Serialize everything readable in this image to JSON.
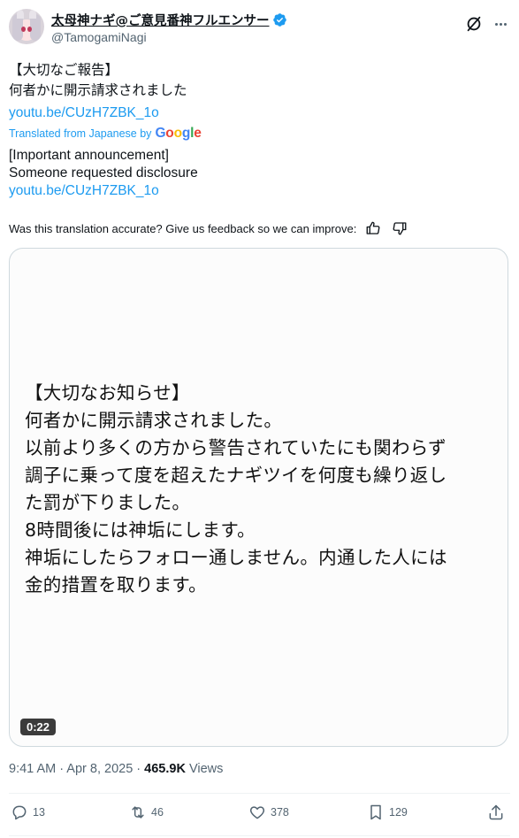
{
  "author": {
    "display_name": "太母神ナギ@ご意見番神フルエンサー",
    "handle": "@TamogamiNagi",
    "verified": true,
    "verified_color": "#1d9bf0"
  },
  "tweet": {
    "lines": [
      "【大切なご報告】",
      "何者かに開示請求されました"
    ],
    "link": "youtu.be/CUzH7ZBK_1o"
  },
  "translation": {
    "label": "Translated from Japanese by",
    "provider": "Google",
    "lines": [
      "[Important announcement]",
      "Someone requested disclosure"
    ],
    "link": "youtu.be/CUzH7ZBK_1o",
    "feedback_prompt": "Was this translation accurate? Give us feedback so we can improve:"
  },
  "media": {
    "lines": [
      "【大切なお知らせ】",
      "何者かに開示請求されました。",
      "以前より多くの方から警告されていたにも関わらず",
      "調子に乗って度を超えたナギツイを何度も繰り返し",
      "た罰が下りました。",
      "8時間後には神垢にします。",
      "神垢にしたらフォロー通しません。内通した人には",
      "金的措置を取ります。"
    ],
    "duration": "0:22"
  },
  "meta": {
    "timestamp": "9:41 AM · Apr 8, 2025",
    "separator": " · ",
    "views_count": "465.9K",
    "views_label": "Views"
  },
  "actions": {
    "replies": "13",
    "reposts": "46",
    "likes": "378",
    "bookmarks": "129"
  },
  "icons": {
    "reply": "reply-icon",
    "repost": "repost-icon",
    "like": "heart-icon",
    "bookmark": "bookmark-icon",
    "share": "share-icon",
    "grok": "grok-icon",
    "more": "more-icon"
  },
  "colors": {
    "text": "#0f1419",
    "secondary": "#536471",
    "link": "#1d9bf0",
    "border": "#cfd9de"
  }
}
